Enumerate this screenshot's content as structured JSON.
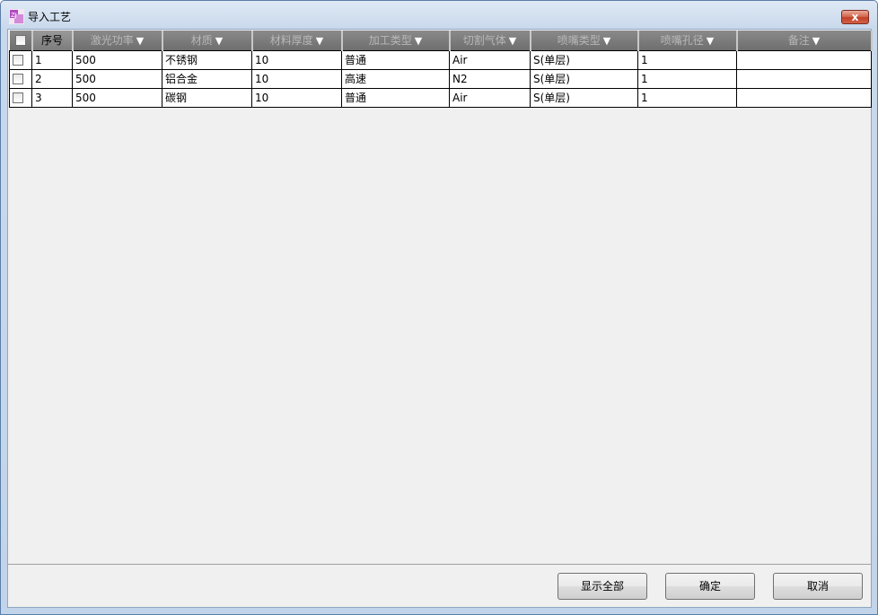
{
  "window": {
    "title": "导入工艺",
    "close_label": "x"
  },
  "colors": {
    "header_bg": "#7a7a7a",
    "header_text": "#b8b8b8",
    "title_bar": "#c9d9ec",
    "close_button": "#c2412a"
  },
  "table": {
    "columns": [
      "序号",
      "激光功率",
      "材质",
      "材料厚度",
      "加工类型",
      "切割气体",
      "喷嘴类型",
      "喷嘴孔径",
      "备注"
    ],
    "filter_icon": "▼",
    "rows": [
      {
        "no": "1",
        "power": "500",
        "material": "不锈钢",
        "thickness": "10",
        "process": "普通",
        "gas": "Air",
        "nozzle_type": "S(单层)",
        "nozzle_diameter": "1",
        "remark": ""
      },
      {
        "no": "2",
        "power": "500",
        "material": "铝合金",
        "thickness": "10",
        "process": "高速",
        "gas": "N2",
        "nozzle_type": "S(单层)",
        "nozzle_diameter": "1",
        "remark": ""
      },
      {
        "no": "3",
        "power": "500",
        "material": "碳钢",
        "thickness": "10",
        "process": "普通",
        "gas": "Air",
        "nozzle_type": "S(单层)",
        "nozzle_diameter": "1",
        "remark": ""
      }
    ]
  },
  "buttons": {
    "show_all": "显示全部",
    "ok": "确定",
    "cancel": "取消"
  }
}
